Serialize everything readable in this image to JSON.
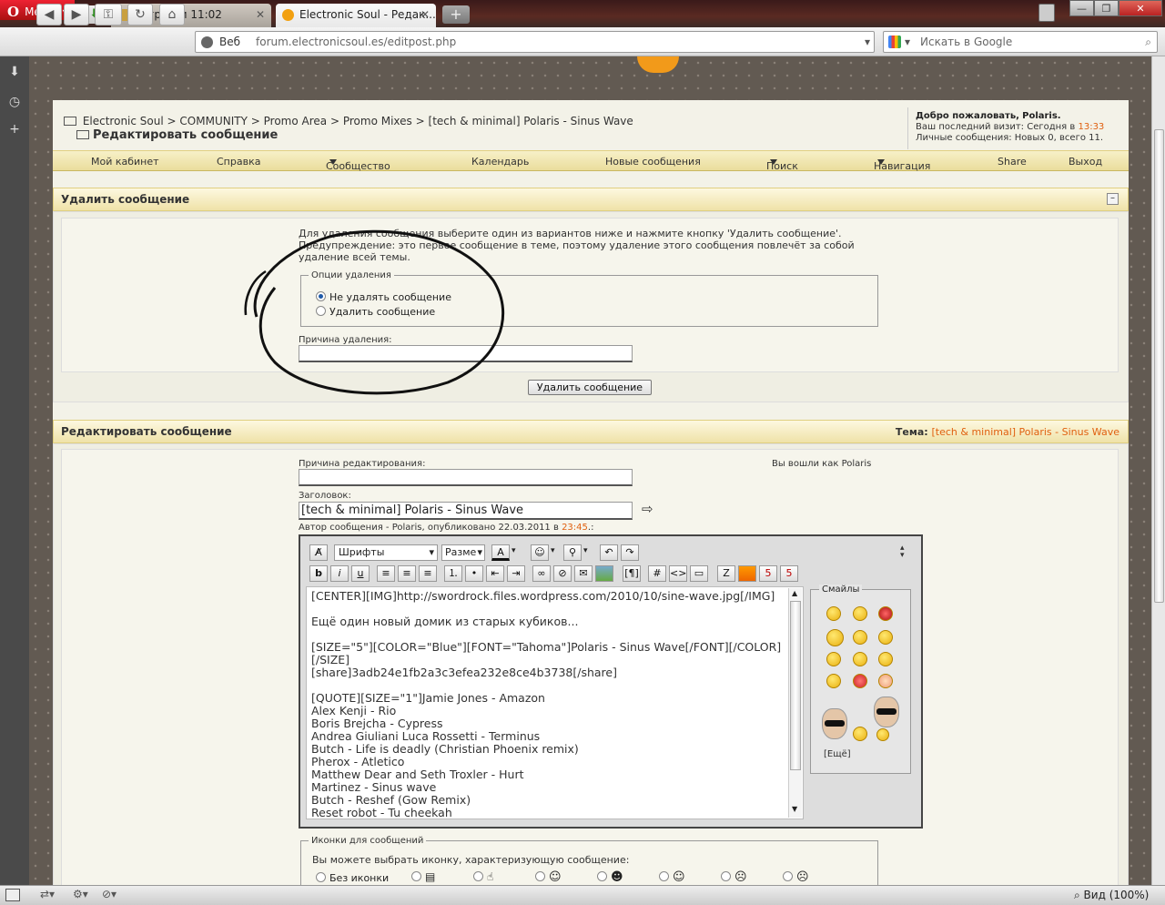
{
  "browser": {
    "menu_label": "Меню",
    "tabs": [
      {
        "title": "Загрузки 11:02"
      },
      {
        "title": "Electronic Soul - Редак..."
      }
    ],
    "address": {
      "prefix": "Веб",
      "url": "forum.electronicsoul.es/editpost.php"
    },
    "search": {
      "placeholder": "Искать в Google"
    },
    "status": {
      "zoom": "Вид (100%)"
    }
  },
  "header": {
    "breadcrumb": [
      "Electronic Soul",
      "COMMUNITY",
      "Promo Area",
      "Promo Mixes",
      "[tech & minimal] Polaris - Sinus Wave"
    ],
    "breadcrumb_sep": ">",
    "page_title": "Редактировать сообщение",
    "welcome": {
      "greeting": "Добро пожаловать,",
      "user": "Polaris.",
      "last_visit_label": "Ваш последний визит: Сегодня в",
      "last_visit_time": "13:33",
      "pm_label": "Личные сообщения:",
      "pm_value": "Новых 0, всего 11."
    }
  },
  "navbar": [
    {
      "label": "Мой кабинет",
      "dropdown": false
    },
    {
      "label": "Справка",
      "dropdown": false
    },
    {
      "label": "Сообщество",
      "dropdown": true
    },
    {
      "label": "Календарь",
      "dropdown": false
    },
    {
      "label": "Новые сообщения",
      "dropdown": false
    },
    {
      "label": "Поиск",
      "dropdown": true
    },
    {
      "label": "Навигация",
      "dropdown": true
    },
    {
      "label": "Share",
      "dropdown": false
    },
    {
      "label": "Выход",
      "dropdown": false
    }
  ],
  "delete_section": {
    "title": "Удалить сообщение",
    "instructions": "Для удаления сообщения выберите один из вариантов ниже и нажмите кнопку 'Удалить сообщение'.",
    "warning": "Предупреждение: это первое сообщение в теме, поэтому удаление этого сообщения повлечёт за собой",
    "warning2": "удаление всей темы.",
    "options_legend": "Опции удаления",
    "option_keep": "Не удалять сообщение",
    "option_delete": "Удалить сообщение",
    "selected": "Не удалять сообщение",
    "reason_label": "Причина удаления:",
    "reason_value": "",
    "submit": "Удалить сообщение"
  },
  "edit_section": {
    "title": "Редактировать сообщение",
    "topic_label": "Тема:",
    "topic_value": "[tech & minimal] Polaris - Sinus Wave",
    "edit_reason_label": "Причина редактирования:",
    "edit_reason_value": "",
    "logged_in_label": "Вы вошли как",
    "logged_in_user": "Polaris",
    "subject_label": "Заголовок:",
    "subject_value": "[tech & minimal] Polaris - Sinus Wave",
    "author_line_prefix": "Автор сообщения -",
    "author": "Polaris",
    "published_label": ", опубликовано 22.03.2011 в",
    "published_time": "23:45",
    "published_suffix": ".:",
    "toolbar": {
      "font_select": "Шрифты",
      "size_select": "Разме"
    },
    "text_lines": [
      "[CENTER][IMG]http://swordrock.files.wordpress.com/2010/10/sine-wave.jpg[/IMG]",
      "",
      "Ещё один новый домик из старых кубиков...",
      "",
      "[SIZE=\"5\"][COLOR=\"Blue\"][FONT=\"Tahoma\"]Polaris - Sinus Wave[/FONT][/COLOR]",
      "[/SIZE]",
      "[share]3adb24e1fb2a3c3efea232e8ce4b3738[/share]",
      "",
      "[QUOTE][SIZE=\"1\"]Jamie Jones - Amazon",
      "Alex Kenji - Rio",
      "Boris Brejcha - Cypress",
      "Andrea Giuliani Luca Rossetti - Terminus",
      "Butch - Life is deadly (Christian Phoenix remix)",
      "Pherox - Atletico",
      "Matthew Dear and Seth Troxler - Hurt",
      "Martinez - Sinus wave",
      "Butch - Reshef (Gow Remix)",
      "Reset robot - Tu cheekah"
    ],
    "smilies_legend": "Смайлы",
    "smilies_more": "[Ещё]",
    "icons_legend": "Иконки для сообщений",
    "icons_hint": "Вы можете выбрать иконку, характеризующую сообщение:",
    "icons_none": "Без иконки"
  },
  "colors": {
    "accent_orange": "#e06010",
    "header_yellow": "#efe2a8",
    "browser_red": "#cc1122"
  }
}
